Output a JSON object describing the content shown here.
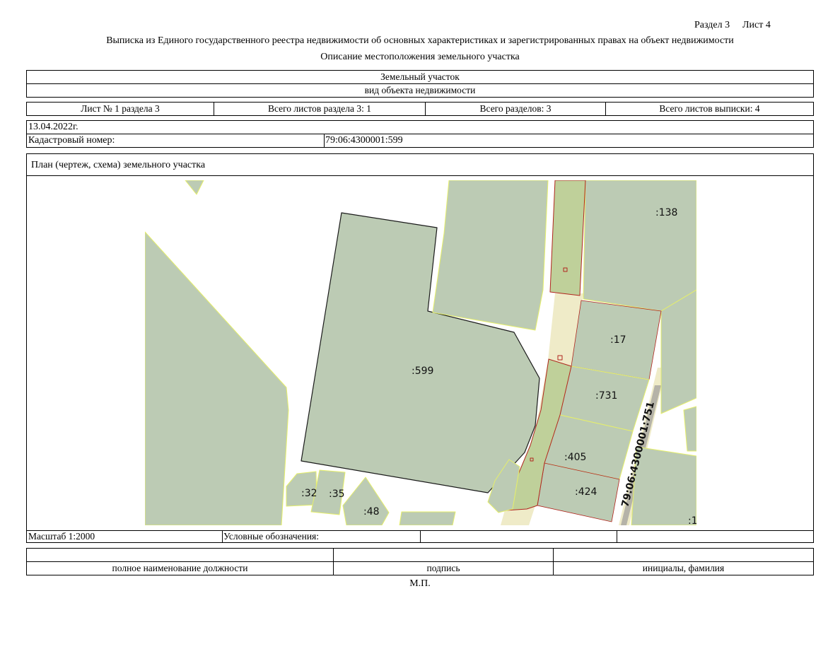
{
  "header": {
    "section": "Раздел 3",
    "sheet": "Лист 4",
    "title": "Выписка из Единого государственного реестра недвижимости об основных характеристиках и зарегистрированных правах на объект недвижимости",
    "subtitle": "Описание местоположения земельного участка"
  },
  "object": {
    "type_value": "Земельный участок",
    "type_caption": "вид объекта недвижимости"
  },
  "sheets_row": {
    "sheet_of_section": "Лист № 1 раздела 3",
    "total_sheets_section": "Всего листов раздела 3: 1",
    "total_sections": "Всего разделов: 3",
    "total_sheets_extract": "Всего листов выписки: 4"
  },
  "info": {
    "date": "13.04.2022г.",
    "cadastral_label": "Кадастровый номер:",
    "cadastral_number": "79:06:4300001:599"
  },
  "plan": {
    "title": "План (чертеж, схема) земельного участка",
    "parcel_labels": {
      "p138": ":138",
      "p599": ":599",
      "p17": ":17",
      "p731": ":731",
      "p405": ":405",
      "p424": ":424",
      "p32": ":32",
      "p35": ":35",
      "p48": ":48",
      "p1": ":1",
      "road": "79:06:4300001:751"
    },
    "colors": {
      "parcel_fill": "#bccbb4",
      "highlight_fill": "#bfd09a",
      "road_fill": "#efebc8",
      "parcel_edge": "#e6ef6a",
      "highlight_edge": "#b0261e"
    }
  },
  "scale_row": {
    "scale": "Масштаб 1:2000",
    "legend_label": "Условные обозначения:"
  },
  "signature": {
    "position": "полное наименование должности",
    "signature": "подпись",
    "name": "инициалы, фамилия",
    "stamp": "М.П."
  }
}
